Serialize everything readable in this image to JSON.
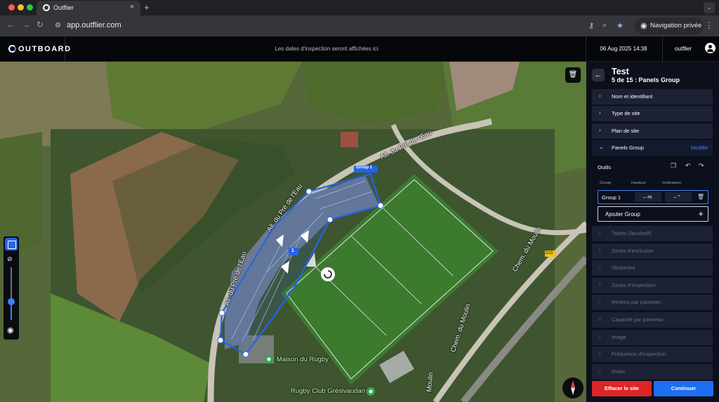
{
  "browser": {
    "tab_title": "Outflier",
    "url": "app.outflier.com",
    "private_label": "Navigation privée",
    "new_tab_icon": "+",
    "close_icon": "×"
  },
  "header": {
    "logo_text": "OUTBOARD",
    "notice": "Les dates d'inspection seront affichées ici",
    "datetime": "06 Aug 2025 14:38",
    "user": "outflier"
  },
  "map": {
    "labels": {
      "road_top": "All. du Pré de l'Eau",
      "road_left_upper": "All. du Pré de l'Eau",
      "road_left_lower": "All. du Pré de l'Eau",
      "chemin_upper": "Chem. du Moulin",
      "chemin_lower": "Chem. du Moulin",
      "d11": "D11",
      "maison": "Maison du Rugby",
      "club": "Rugby Club Grésivaudan",
      "moulin_bottom": "Moulin"
    },
    "group_tag": "Group 1",
    "group_index": "1",
    "opacity_level": 0.35
  },
  "panel": {
    "title": "Test",
    "step": "5 de 15 : Panels Group",
    "sections_top": [
      {
        "label": "Nom et identifiant"
      },
      {
        "label": "Type de site"
      },
      {
        "label": "Plan de site"
      }
    ],
    "open_section": {
      "label": "Panels Group",
      "tag": "Modifié"
    },
    "outils_label": "Outils",
    "columns": {
      "group": "Group",
      "hauteur": "Hauteur",
      "inclinaison": "Inclinaison"
    },
    "group_row": {
      "name": "Group 1",
      "hauteur": "– m",
      "inclinaison": "– °"
    },
    "add_group_label": "Ajouter Group",
    "sections_bottom": [
      {
        "label": "Tables (facultatif)"
      },
      {
        "label": "Zones d'exclusion"
      },
      {
        "label": "Obstacles"
      },
      {
        "label": "Zones d'inspection"
      },
      {
        "label": "Revenu par panneau"
      },
      {
        "label": "Capacité par panneau"
      },
      {
        "label": "Image"
      },
      {
        "label": "Fréquence d'inspection"
      },
      {
        "label": "Roles"
      }
    ],
    "delete_label": "Effacer le site",
    "continue_label": "Continuer"
  },
  "colors": {
    "accent": "#1d6ff2",
    "danger": "#dc2626",
    "panel_bg": "#0c0f1c"
  }
}
